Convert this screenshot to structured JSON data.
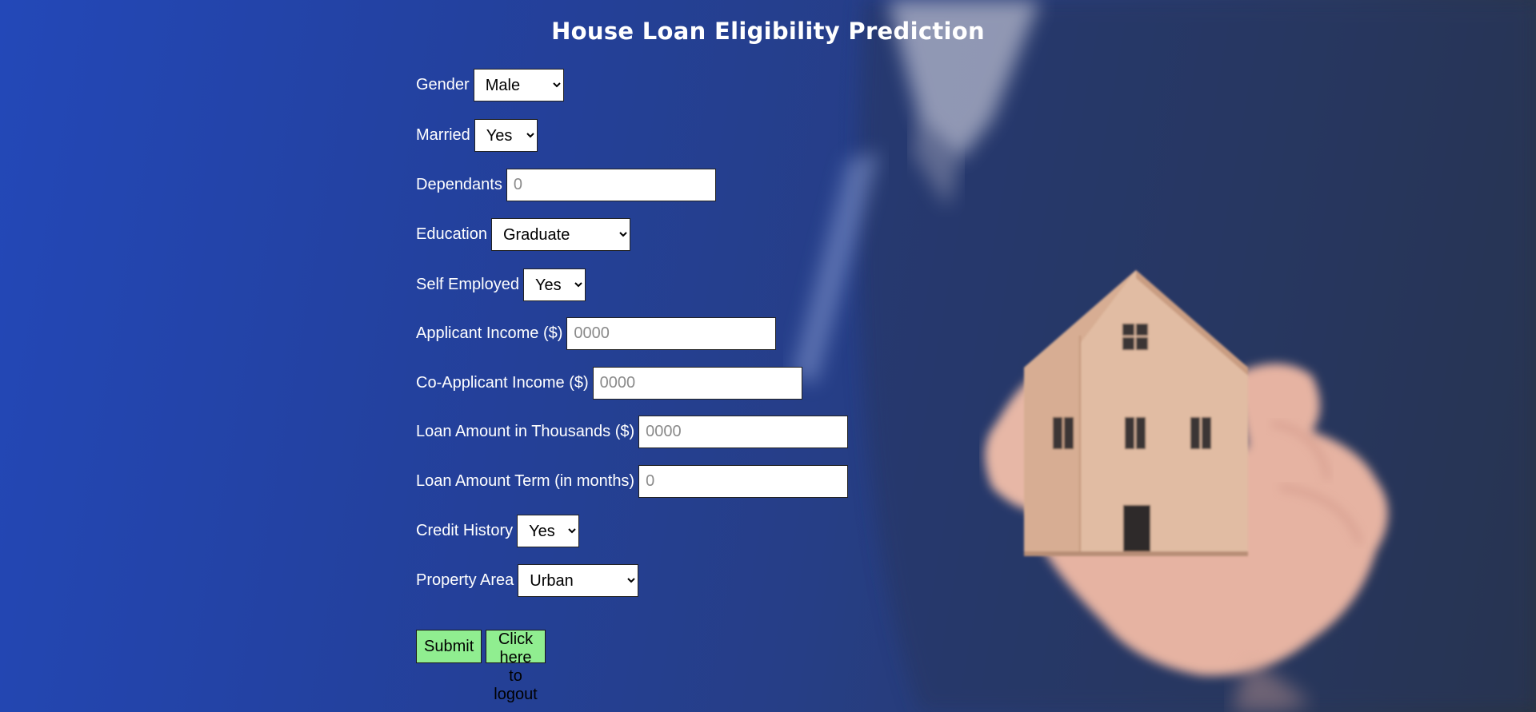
{
  "page": {
    "title": "House Loan Eligibility Prediction"
  },
  "form": {
    "gender": {
      "label": "Gender",
      "selected": "Male",
      "options": [
        "Male"
      ]
    },
    "married": {
      "label": "Married",
      "selected": "Yes",
      "options": [
        "Yes"
      ]
    },
    "dependants": {
      "label": "Dependants",
      "value": "",
      "placeholder": "0"
    },
    "education": {
      "label": "Education",
      "selected": "Graduate",
      "options": [
        "Graduate"
      ]
    },
    "self_employed": {
      "label": "Self Employed",
      "selected": "Yes",
      "options": [
        "Yes"
      ]
    },
    "applicant_income": {
      "label": "Applicant Income ($)",
      "value": "",
      "placeholder": "0000"
    },
    "coapplicant_income": {
      "label": "Co-Applicant Income ($)",
      "value": "",
      "placeholder": "0000"
    },
    "loan_amount": {
      "label": "Loan Amount in Thousands ($)",
      "value": "",
      "placeholder": "0000"
    },
    "loan_term": {
      "label": "Loan Amount Term (in months)",
      "value": "",
      "placeholder": "0"
    },
    "credit_history": {
      "label": "Credit History",
      "selected": "Yes",
      "options": [
        "Yes"
      ]
    },
    "property_area": {
      "label": "Property Area",
      "selected": "Urban",
      "options": [
        "Urban"
      ]
    }
  },
  "actions": {
    "submit_label": "Submit",
    "logout_label": "Click here to logout"
  },
  "colors": {
    "button_bg": "#90ee90",
    "background_blue": "#2348b8",
    "text": "#ffffff"
  },
  "icons": {
    "background_image": "hand-holding-house-image",
    "select_arrow": "chevron-down-icon"
  }
}
